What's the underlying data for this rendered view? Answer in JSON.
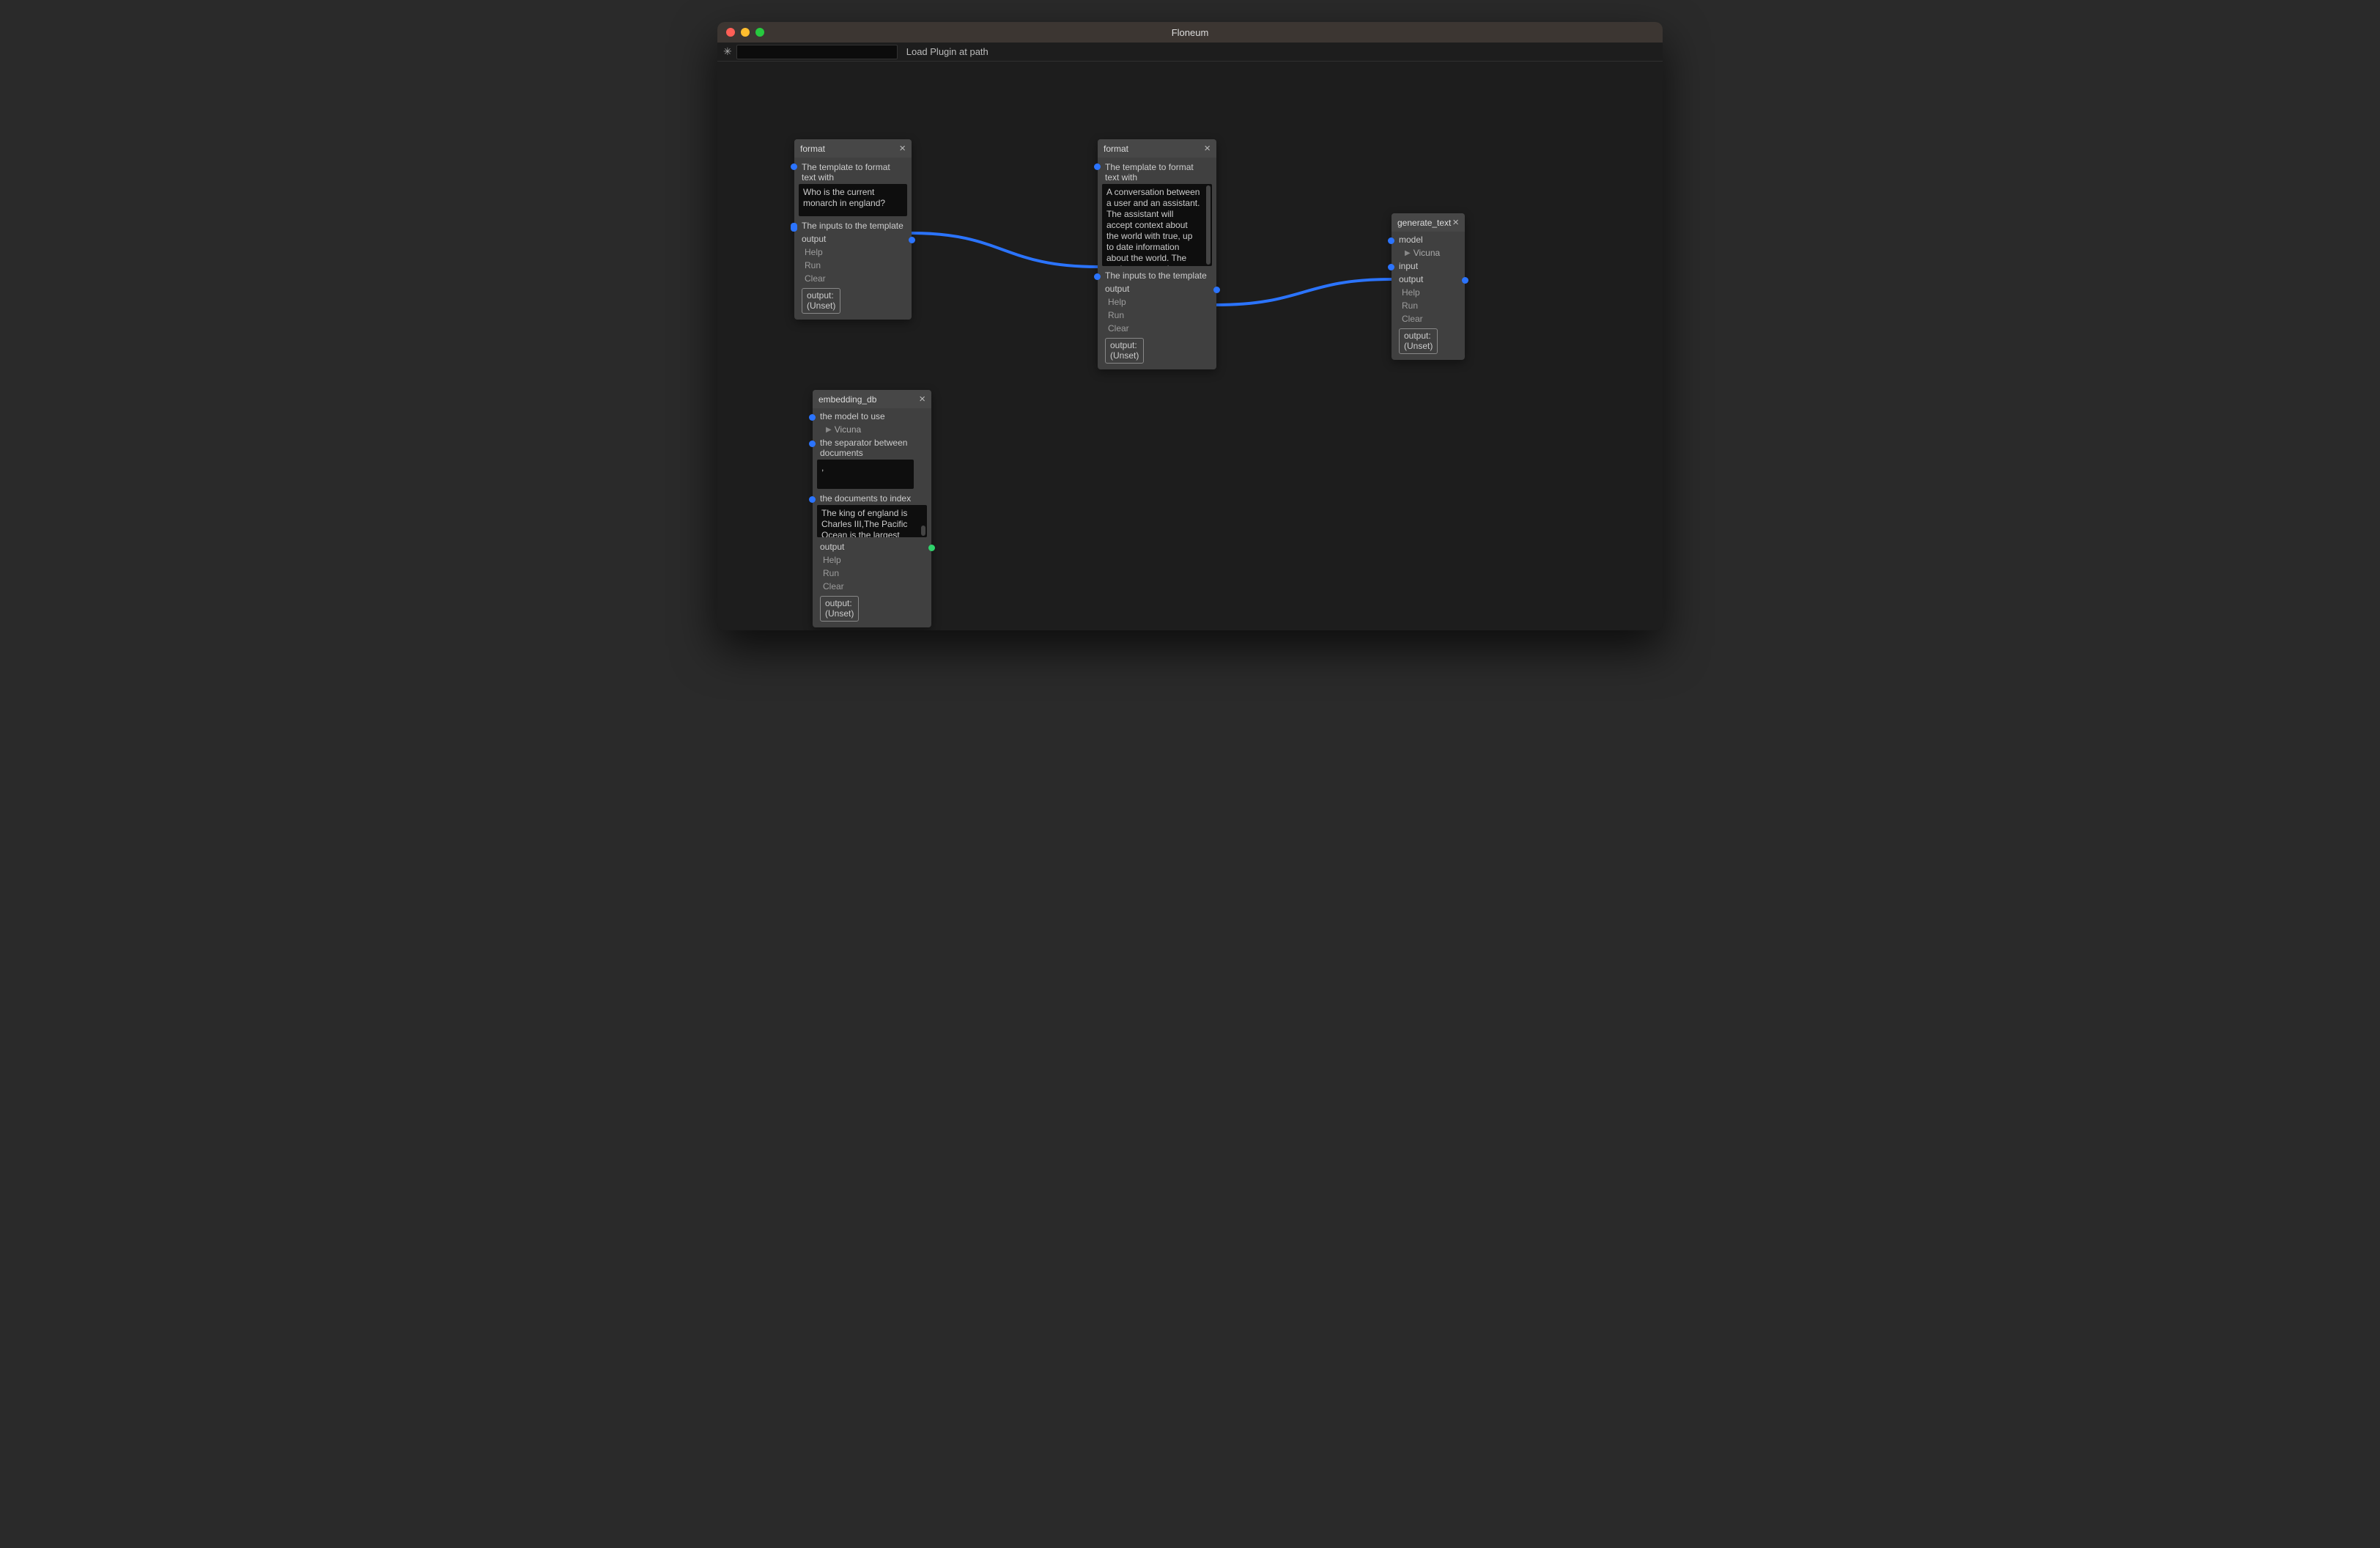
{
  "window": {
    "title": "Floneum"
  },
  "toolbar": {
    "load_plugin_label": "Load Plugin at path"
  },
  "labels": {
    "output": "output",
    "help": "Help",
    "run": "Run",
    "clear": "Clear",
    "output_box_label": "output:",
    "output_box_value": "(Unset)"
  },
  "nodes": {
    "format1": {
      "title": "format",
      "template_label": "The template to format text with",
      "template_value": "Who is the current monarch in england?",
      "inputs_label": "The inputs to the template"
    },
    "format2": {
      "title": "format",
      "template_label": "The template to format text with",
      "template_value": "A conversation between a user and an assistant. The assistant will accept context about the world with true, up to date information about the world. The assistant uses the infomation in the context to answer susinctly:",
      "inputs_label": "The inputs to the template"
    },
    "generate_text": {
      "title": "generate_text",
      "model_label": "model",
      "model_value": "Vicuna",
      "input_label": "input",
      "output_label": "output"
    },
    "embedding_db": {
      "title": "embedding_db",
      "model_label": "the model to use",
      "model_value": "Vicuna",
      "separator_label": "the separator between documents",
      "separator_value": ",",
      "documents_label": "the documents to index",
      "documents_value": "The king of england is Charles III,The Pacific Ocean is the largest ocean which covers"
    }
  }
}
